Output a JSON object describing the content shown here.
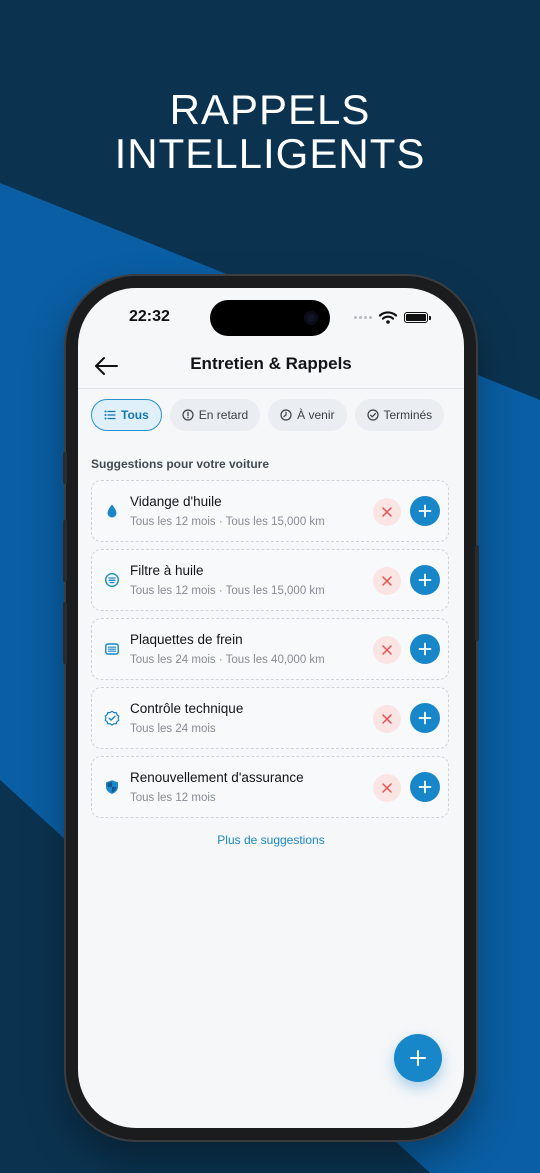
{
  "headline": {
    "line1": "RAPPELS",
    "line2": "INTELLIGENTS"
  },
  "status_bar": {
    "time": "22:32"
  },
  "nav": {
    "title": "Entretien & Rappels"
  },
  "filters": [
    {
      "label": "Tous",
      "icon": "list-icon",
      "active": true
    },
    {
      "label": "En retard",
      "icon": "alert-circle-icon",
      "active": false
    },
    {
      "label": "À venir",
      "icon": "clock-icon",
      "active": false
    },
    {
      "label": "Terminés",
      "icon": "check-circle-icon",
      "active": false
    }
  ],
  "suggestions": {
    "title": "Suggestions pour votre voiture",
    "items": [
      {
        "title": "Vidange d'huile",
        "subtitle": "Tous les 12 mois · Tous les 15,000 km",
        "icon": "oil-drop-icon"
      },
      {
        "title": "Filtre à huile",
        "subtitle": "Tous les 12 mois · Tous les 15,000 km",
        "icon": "filter-icon"
      },
      {
        "title": "Plaquettes de frein",
        "subtitle": "Tous les 24 mois · Tous les 40,000 km",
        "icon": "brake-pad-icon"
      },
      {
        "title": "Contrôle technique",
        "subtitle": "Tous les 24 mois",
        "icon": "badge-check-icon"
      },
      {
        "title": "Renouvellement d'assurance",
        "subtitle": "Tous les 12 mois",
        "icon": "shield-icon"
      }
    ],
    "more_label": "Plus de suggestions"
  },
  "colors": {
    "accent": "#1887c9",
    "background_dark": "#0b3350",
    "background_blue": "#0a5ea3",
    "reject_bg": "#fbe4e4",
    "reject_icon": "#e0544f"
  }
}
